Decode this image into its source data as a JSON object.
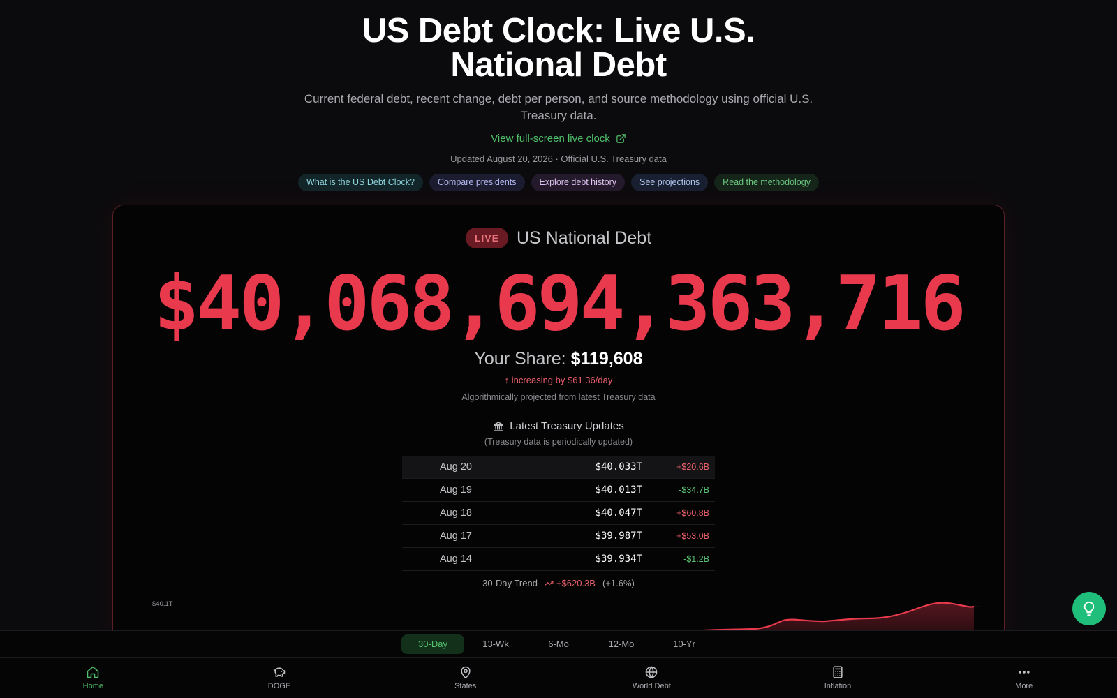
{
  "page": {
    "title": "US Debt Clock: Live U.S. National Debt",
    "subtitle": "Current federal debt, recent change, debt per person, and source methodology using official U.S. Treasury data.",
    "fullscreen_link": "View full-screen live clock",
    "updated": "Updated August 20, 2026 · Official U.S. Treasury data"
  },
  "pills": [
    "What is the US Debt Clock?",
    "Compare presidents",
    "Explore debt history",
    "See projections",
    "Read the methodology"
  ],
  "card": {
    "badge": "LIVE",
    "label": "US National Debt",
    "debt": "$40,068,694,363,716",
    "share_label": "Your Share:",
    "share_value": "$119,608",
    "rate": "increasing by $61.36/day",
    "algo_note": "Algorithmically projected from latest Treasury data",
    "updates_title": "Latest Treasury Updates",
    "updates_note": "(Treasury data is periodically updated)",
    "trend_label": "30-Day Trend",
    "trend_value": "+$620.3B",
    "trend_pct": "(+1.6%)",
    "y_tick": "$40.1T"
  },
  "updates": [
    {
      "date": "Aug 20",
      "value": "$40.033T",
      "change": "+$20.6B",
      "dir": "up"
    },
    {
      "date": "Aug 19",
      "value": "$40.013T",
      "change": "-$34.7B",
      "dir": "down"
    },
    {
      "date": "Aug 18",
      "value": "$40.047T",
      "change": "+$60.8B",
      "dir": "up"
    },
    {
      "date": "Aug 17",
      "value": "$39.987T",
      "change": "+$53.0B",
      "dir": "up"
    },
    {
      "date": "Aug 14",
      "value": "$39.934T",
      "change": "-$1.2B",
      "dir": "down"
    }
  ],
  "range_tabs": [
    "30-Day",
    "13-Wk",
    "6-Mo",
    "12-Mo",
    "10-Yr"
  ],
  "range_active": "30-Day",
  "nav": [
    {
      "label": "Home",
      "icon": "home-icon",
      "active": true
    },
    {
      "label": "DOGE",
      "icon": "piggy-bank-icon",
      "active": false
    },
    {
      "label": "States",
      "icon": "map-pin-icon",
      "active": false
    },
    {
      "label": "World Debt",
      "icon": "globe-icon",
      "active": false
    },
    {
      "label": "Inflation",
      "icon": "calculator-icon",
      "active": false
    },
    {
      "label": "More",
      "icon": "more-dots-icon",
      "active": false
    }
  ],
  "colors": {
    "accent_red": "#e8394d",
    "accent_green": "#4fbf6a",
    "tip_button": "#1fbe7a"
  }
}
